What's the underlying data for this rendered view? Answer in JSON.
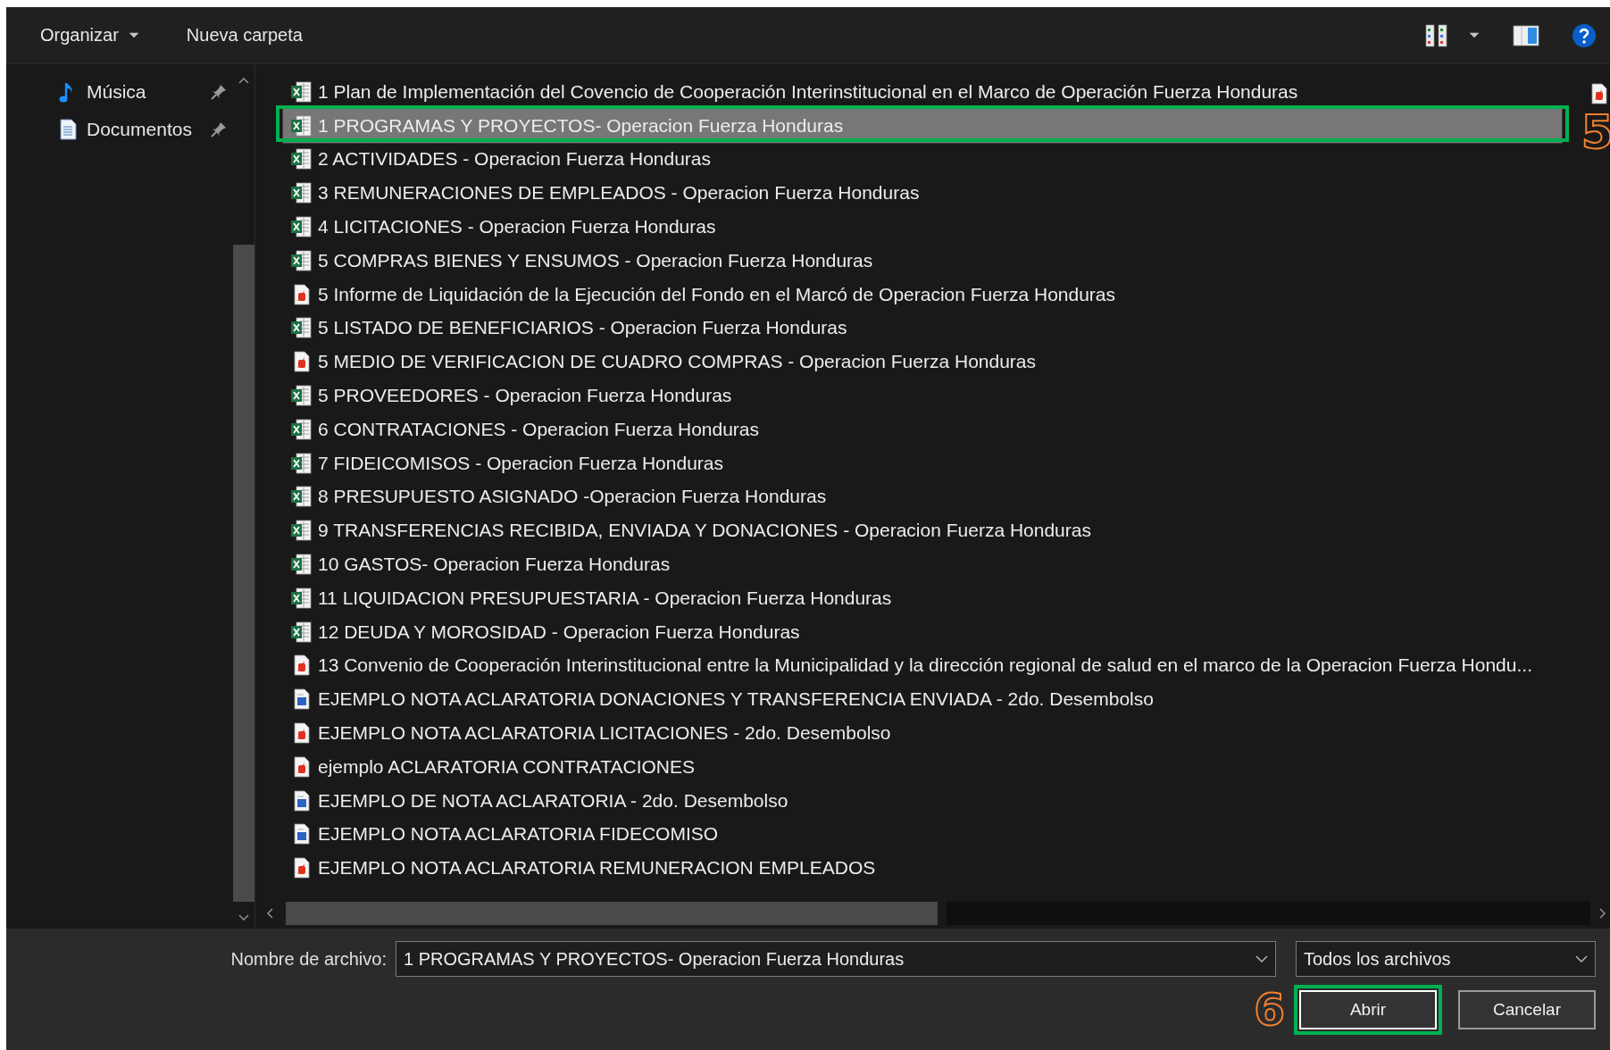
{
  "toolbar": {
    "organize_label": "Organizar",
    "new_folder_label": "Nueva carpeta"
  },
  "nav_pane": {
    "items": [
      {
        "label": "Música",
        "kind": "music",
        "pinned": true
      },
      {
        "label": "Documentos",
        "kind": "document",
        "pinned": true
      }
    ]
  },
  "files": [
    {
      "name": "1 Plan de Implementación del Covencio de Cooperación Interinstitucional en el Marco de Operación Fuerza Honduras",
      "kind": "excel",
      "selected": false
    },
    {
      "name": "1 PROGRAMAS Y PROYECTOS- Operacion Fuerza Honduras",
      "kind": "excel",
      "selected": true
    },
    {
      "name": "2 ACTIVIDADES - Operacion Fuerza Honduras",
      "kind": "excel",
      "selected": false
    },
    {
      "name": "3 REMUNERACIONES DE EMPLEADOS - Operacion Fuerza Honduras",
      "kind": "excel",
      "selected": false
    },
    {
      "name": "4 LICITACIONES  - Operacion Fuerza Honduras",
      "kind": "excel",
      "selected": false
    },
    {
      "name": "5 COMPRAS BIENES Y ENSUMOS - Operacion Fuerza Honduras",
      "kind": "excel",
      "selected": false
    },
    {
      "name": "5 Informe de Liquidación de la Ejecución del Fondo en el Marcó de Operacion Fuerza Honduras",
      "kind": "pdf",
      "selected": false
    },
    {
      "name": "5 LISTADO DE BENEFICIARIOS - Operacion Fuerza Honduras",
      "kind": "excel",
      "selected": false
    },
    {
      "name": "5 MEDIO DE VERIFICACION DE CUADRO COMPRAS - Operacion Fuerza Honduras",
      "kind": "pdf",
      "selected": false
    },
    {
      "name": "5 PROVEEDORES - Operacion Fuerza Honduras",
      "kind": "excel",
      "selected": false
    },
    {
      "name": "6 CONTRATACIONES - Operacion Fuerza Honduras",
      "kind": "excel",
      "selected": false
    },
    {
      "name": "7 FIDEICOMISOS  - Operacion Fuerza Honduras",
      "kind": "excel",
      "selected": false
    },
    {
      "name": "8 PRESUPUESTO ASIGNADO -Operacion Fuerza Honduras",
      "kind": "excel",
      "selected": false
    },
    {
      "name": "9 TRANSFERENCIAS RECIBIDA, ENVIADA Y DONACIONES - Operacion Fuerza Honduras",
      "kind": "excel",
      "selected": false
    },
    {
      "name": "10 GASTOS- Operacion Fuerza Honduras",
      "kind": "excel",
      "selected": false
    },
    {
      "name": "11 LIQUIDACION PRESUPUESTARIA - Operacion Fuerza Honduras",
      "kind": "excel",
      "selected": false
    },
    {
      "name": "12 DEUDA Y MOROSIDAD - Operacion Fuerza Honduras",
      "kind": "excel",
      "selected": false
    },
    {
      "name": "13 Convenio de Cooperación Interinstitucional entre la Municipalidad y la dirección regional de salud en el marco de la Operacion Fuerza Hondu...",
      "kind": "pdf",
      "selected": false
    },
    {
      "name": "EJEMPLO  NOTA ACLARATORIA DONACIONES Y TRANSFERENCIA ENVIADA - 2do. Desembolso",
      "kind": "doc",
      "selected": false
    },
    {
      "name": "EJEMPLO  NOTA ACLARATORIA LICITACIONES - 2do. Desembolso",
      "kind": "pdf",
      "selected": false
    },
    {
      "name": "ejemplo ACLARATORIA CONTRATACIONES",
      "kind": "pdf",
      "selected": false
    },
    {
      "name": "EJEMPLO DE  NOTA ACLARATORIA - 2do. Desembolso",
      "kind": "doc",
      "selected": false
    },
    {
      "name": "EJEMPLO NOTA ACLARATORIA FIDECOMISO",
      "kind": "doc",
      "selected": false
    },
    {
      "name": "EJEMPLO NOTA ACLARATORIA REMUNERACION EMPLEADOS",
      "kind": "pdf",
      "selected": false
    }
  ],
  "next_column_icons": [
    {
      "kind": "pdf"
    }
  ],
  "annotations": {
    "selected_file_marker": "5",
    "open_button_marker": "6"
  },
  "footer": {
    "filename_label": "Nombre de archivo:",
    "filename_value": "1 PROGRAMAS Y PROYECTOS- Operacion Fuerza Honduras",
    "filter_value": "Todos los archivos",
    "buttons": [
      {
        "label": "Abrir",
        "kind": "primary"
      },
      {
        "label": "Cancelar",
        "kind": "secondary"
      }
    ]
  }
}
